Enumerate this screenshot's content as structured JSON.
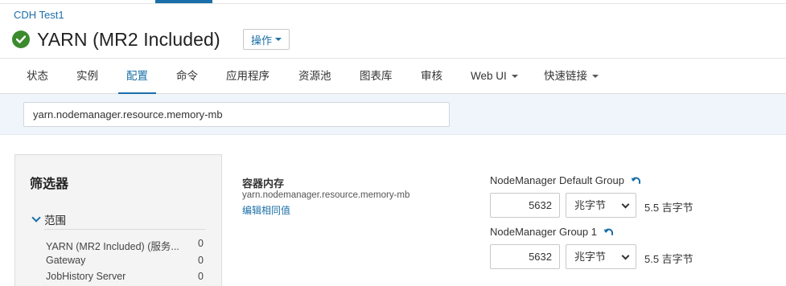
{
  "breadcrumb": {
    "cluster": "CDH Test1"
  },
  "header": {
    "title": "YARN (MR2 Included)",
    "actions_label": "操作"
  },
  "colors": {
    "accent": "#1a6fa8",
    "ok": "#3c8a2e"
  },
  "nav": {
    "tabs": [
      {
        "label": "状态"
      },
      {
        "label": "实例"
      },
      {
        "label": "配置"
      },
      {
        "label": "命令"
      },
      {
        "label": "应用程序"
      },
      {
        "label": "资源池"
      },
      {
        "label": "图表库"
      },
      {
        "label": "审核"
      },
      {
        "label": "Web UI"
      },
      {
        "label": "快速链接"
      }
    ],
    "active": "配置"
  },
  "search": {
    "value": "yarn.nodemanager.resource.memory-mb"
  },
  "filters": {
    "title": "筛选器",
    "scope": {
      "label": "范围",
      "items": [
        {
          "name": "YARN (MR2 Included) (服务...",
          "count": "0"
        },
        {
          "name": "Gateway",
          "count": "0"
        },
        {
          "name": "JobHistory Server",
          "count": "0"
        }
      ]
    }
  },
  "property": {
    "label": "容器内存",
    "key": "yarn.nodemanager.resource.memory-mb",
    "edit_link": "编辑相同值",
    "groups": [
      {
        "name": "NodeManager Default Group",
        "value": "5632",
        "unit": "兆字节",
        "derived": "5.5 吉字节"
      },
      {
        "name": "NodeManager Group 1",
        "value": "5632",
        "unit": "兆字节",
        "derived": "5.5 吉字节"
      }
    ]
  }
}
